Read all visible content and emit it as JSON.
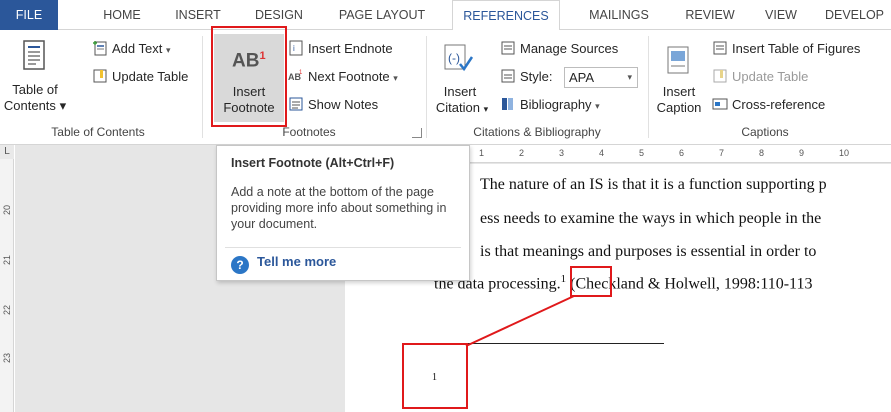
{
  "tabs": [
    {
      "label": "FILE"
    },
    {
      "label": "HOME"
    },
    {
      "label": "INSERT"
    },
    {
      "label": "DESIGN"
    },
    {
      "label": "PAGE LAYOUT"
    },
    {
      "label": "REFERENCES"
    },
    {
      "label": "MAILINGS"
    },
    {
      "label": "REVIEW"
    },
    {
      "label": "VIEW"
    },
    {
      "label": "DEVELOP"
    }
  ],
  "active_tab": "REFERENCES",
  "toc": {
    "add_text": "Add Text",
    "update_table": "Update Table",
    "big_label_1": "Table of",
    "big_label_2": "Contents",
    "group": "Table of Contents"
  },
  "footnotes": {
    "big_icon": "AB",
    "big_icon_sup": "1",
    "big_label_1": "Insert",
    "big_label_2": "Footnote",
    "insert_endnote": "Insert Endnote",
    "next_footnote": "Next Footnote",
    "show_notes": "Show Notes",
    "group": "Footnotes"
  },
  "citations": {
    "manage_sources": "Manage Sources",
    "style_label": "Style:",
    "style_value": "APA",
    "bibliography": "Bibliography",
    "big_label_1": "Insert",
    "big_label_2": "Citation",
    "group": "Citations & Bibliography"
  },
  "captions": {
    "insert_table_of_figures": "Insert Table of Figures",
    "update_table": "Update Table",
    "cross_reference": "Cross-reference",
    "big_label_1": "Insert",
    "big_label_2": "Caption",
    "group": "Captions"
  },
  "tooltip": {
    "title": "Insert Footnote (Alt+Ctrl+F)",
    "body": "Add a note at the bottom of the page providing more info about something in your document.",
    "link": "Tell me more"
  },
  "ruler": {
    "corner": "L",
    "v_numbers": [
      "20",
      "21",
      "22",
      "23"
    ],
    "h_numbers": [
      "1",
      "2",
      "3",
      "4",
      "5",
      "6",
      "7",
      "8",
      "9",
      "10"
    ]
  },
  "document": {
    "line1": "The nature of an IS is that it is a function supporting p",
    "line2": "ess needs to examine the ways in which people in the",
    "line3": "is that meanings and purposes is essential in order to",
    "line4_a": "the data processing.",
    "footnote_ref": "1",
    "line4_b": " (Checkland & Holwell, 1998:110-113",
    "footnote_number": "1"
  },
  "colors": {
    "accent": "#2b579a",
    "highlight": "#e0191b"
  }
}
